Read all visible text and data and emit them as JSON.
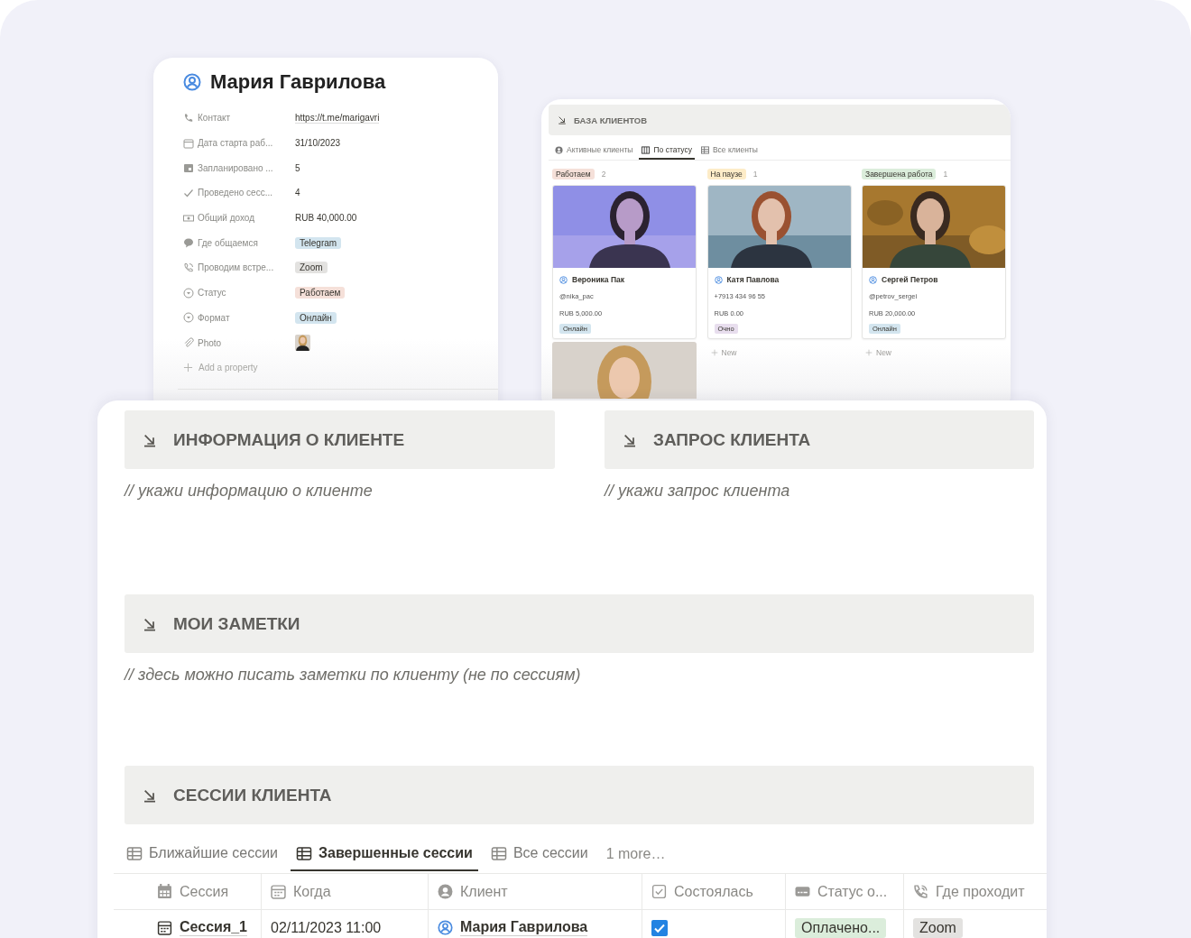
{
  "profile": {
    "title": "Мария Гаврилова",
    "properties": [
      {
        "label": "Контакт",
        "kind": "link",
        "value": "https://t.me/marigavri"
      },
      {
        "label": "Дата старта раб...",
        "kind": "text",
        "value": "31/10/2023"
      },
      {
        "label": "Запланировано ...",
        "kind": "text",
        "value": "5"
      },
      {
        "label": "Проведено сесс...",
        "kind": "text",
        "value": "4"
      },
      {
        "label": "Общий доход",
        "kind": "text",
        "value": "RUB 40,000.00"
      },
      {
        "label": "Где общаемся",
        "kind": "tag",
        "value": "Telegram",
        "color": "#d3e5ef"
      },
      {
        "label": "Проводим встре...",
        "kind": "tag",
        "value": "Zoom",
        "color": "#e3e2e0"
      },
      {
        "label": "Статус",
        "kind": "tag",
        "value": "Работаем",
        "color": "#f5e0d9"
      },
      {
        "label": "Формат",
        "kind": "tag",
        "value": "Онлайн",
        "color": "#d3e5ef"
      },
      {
        "label": "Photo"
      }
    ],
    "add_property": "Add a property"
  },
  "database": {
    "title": "БАЗА КЛИЕНТОВ",
    "tabs": [
      {
        "label": "Активные клиенты",
        "selected": false
      },
      {
        "label": "По статусу",
        "selected": true
      },
      {
        "label": "Все клиенты",
        "selected": false
      }
    ],
    "columns": [
      {
        "status": "Работаем",
        "color": "#f5e0d9",
        "count": "2",
        "cards": [
          {
            "kind": "client",
            "name": "Вероника Пак",
            "contact": "@nika_pac",
            "amount": "RUB 5,000.00",
            "tag": {
              "value": "Онлайн",
              "color": "#d3e5ef"
            }
          },
          {
            "kind": "picture"
          }
        ]
      },
      {
        "status": "На паузе",
        "color": "#fdecc8",
        "count": "1",
        "cards": [
          {
            "kind": "client",
            "name": "Катя Павлова",
            "contact": "+7913 434 96 55",
            "amount": "RUB 0.00",
            "tag": {
              "value": "Очно",
              "color": "#e8deee"
            }
          }
        ],
        "new": "New"
      },
      {
        "status": "Завершена работа",
        "color": "#dbeddb",
        "count": "1",
        "cards": [
          {
            "kind": "client",
            "name": "Сергей Петров",
            "contact": "@petrov_sergei",
            "amount": "RUB 20,000.00",
            "tag": {
              "value": "Онлайн",
              "color": "#d3e5ef"
            }
          }
        ],
        "new": "New"
      }
    ]
  },
  "sections": [
    {
      "title": "ИНФОРМАЦИЯ О КЛИЕНТЕ",
      "hint": "// укажи информацию о клиенте"
    },
    {
      "title": "ЗАПРОС КЛИЕНТА",
      "hint": "// укажи запрос клиента"
    }
  ],
  "notes": {
    "title": "МОИ ЗАМЕТКИ",
    "hint": "// здесь можно писать заметки по клиенту (не по сессиям)"
  },
  "sessions": {
    "title": "СЕССИИ КЛИЕНТА",
    "tabs": [
      {
        "label": "Ближайшие сессии",
        "selected": false
      },
      {
        "label": "Завершенные сессии",
        "selected": true
      },
      {
        "label": "Все сессии",
        "selected": false
      }
    ],
    "more": "1 more…",
    "columns": [
      "Сессия",
      "Когда",
      "Клиент",
      "Состоялась",
      "Статус о...",
      "Где проходит"
    ],
    "rows": [
      {
        "session": "Сессия_1",
        "when": "02/11/2023 11:00",
        "client": "Мария Гаврилова",
        "held": true,
        "payment": {
          "value": "Оплачено...",
          "color": "#dbeddb"
        },
        "place": {
          "value": "Zoom",
          "color": "#e3e2e0"
        }
      }
    ]
  }
}
